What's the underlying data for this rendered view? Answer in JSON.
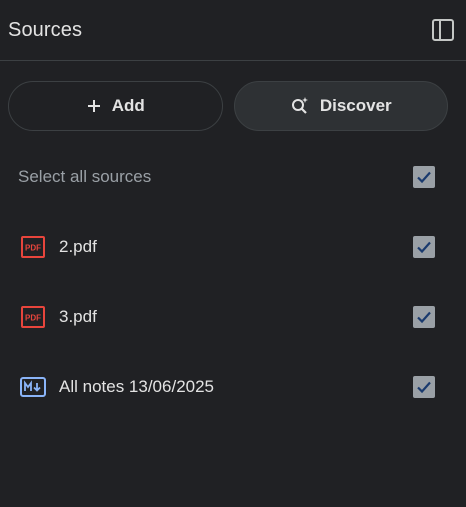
{
  "header": {
    "title": "Sources",
    "toggle_icon": "side-panel-icon"
  },
  "actions": {
    "add_label": "Add",
    "add_icon": "plus-icon",
    "discover_label": "Discover",
    "discover_icon": "search-spark-icon"
  },
  "sources": {
    "select_all_label": "Select all sources",
    "select_all_checked": true,
    "items": [
      {
        "label": "2.pdf",
        "type": "pdf",
        "icon": "pdf-icon",
        "checked": true
      },
      {
        "label": "3.pdf",
        "type": "pdf",
        "icon": "pdf-icon",
        "checked": true
      },
      {
        "label": "All notes 13/06/2025",
        "type": "markdown",
        "icon": "markdown-icon",
        "checked": true
      }
    ]
  },
  "colors": {
    "background": "#202124",
    "pdf_icon": "#e8453c",
    "markdown_icon": "#8ab4f8",
    "checkbox_fill": "#9aa0a6",
    "checkmark": "#1a3a6e"
  }
}
